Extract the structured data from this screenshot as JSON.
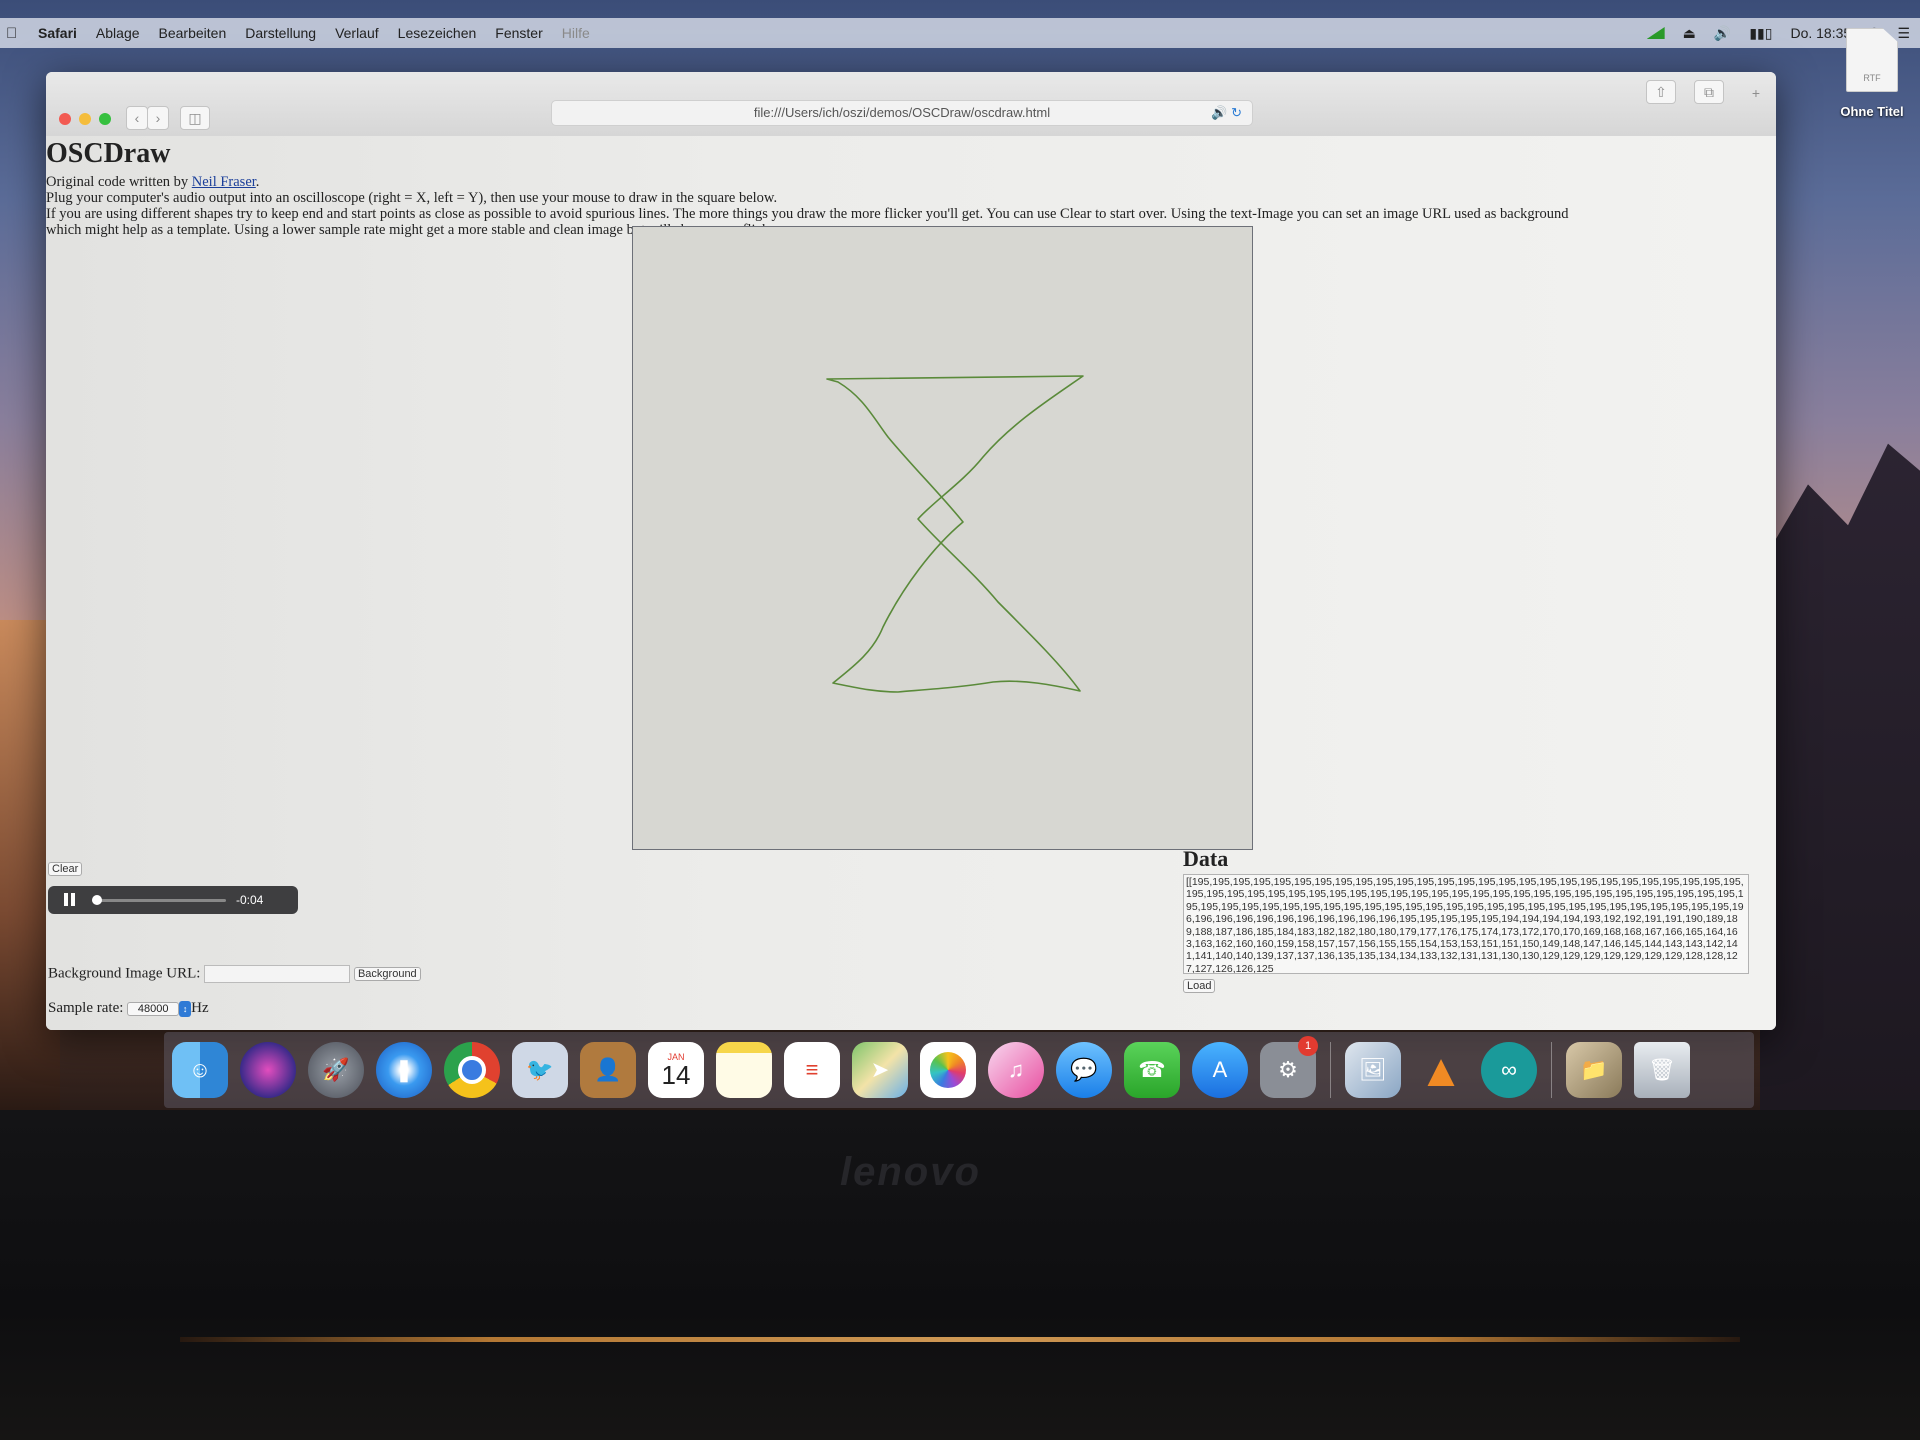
{
  "menubar": {
    "app": "Safari",
    "items": [
      "Ablage",
      "Bearbeiten",
      "Darstellung",
      "Verlauf",
      "Lesezeichen",
      "Fenster",
      "Hilfe"
    ],
    "clock": "Do. 18:35"
  },
  "desktop": {
    "file_badge": "RTF",
    "file_name": "Ohne Titel"
  },
  "browser": {
    "url": "file:///Users/ich/oszi/demos/OSCDraw/oscdraw.html"
  },
  "page": {
    "title": "OSCDraw",
    "credit_prefix": "Original code written by ",
    "credit_link": "Neil Fraser",
    "credit_suffix": ".",
    "line1": "Plug your computer's audio output into an oscilloscope (right = X, left = Y), then use your mouse to draw in the square below.",
    "line2": "If you are using different shapes try to keep end and start points as close as possible to avoid spurious lines. The more things you draw the more flicker you'll get. You can use Clear to start over. Using the text-Image you can set an image URL used as background",
    "line3": "which might help as a template. Using a lower sample rate might get a more stable and clean image but will show more flicker.",
    "clear_label": "Clear",
    "audio_time": "-0:04",
    "bg_label": "Background Image URL:",
    "bg_button": "Background",
    "rate_label": "Sample rate:",
    "rate_value": "48000",
    "rate_unit": "Hz",
    "data_heading": "Data",
    "data_text": "[[195,195,195,195,195,195,195,195,195,195,195,195,195,195,195,195,195,195,195,195,195,195,195,195,195,195,195,195,195,195,195,195,195,195,195,195,195,195,195,195,195,195,195,195,195,195,195,195,195,195,195,195,195,195,195,195,195,195,195,195,195,195,195,195,195,195,195,195,195,195,195,195,195,195,195,195,195,195,195,195,195,196,196,196,196,196,196,196,196,196,196,196,195,195,195,195,195,194,194,194,194,193,192,192,191,191,190,189,189,188,187,186,185,184,183,182,182,180,180,179,177,176,175,174,173,172,170,170,169,168,168,167,166,165,164,163,163,162,160,160,159,158,157,157,156,155,155,154,153,153,151,151,150,149,148,147,146,145,144,143,143,142,141,141,140,140,139,137,137,136,135,135,134,134,133,132,131,131,130,130,129,129,129,129,129,129,129,128,128,127,127,126,126,125",
    "load_label": "Load"
  },
  "dock": {
    "calendar_month": "JAN",
    "calendar_day": "14",
    "settings_badge": "1"
  },
  "bezel": {
    "brand": "lenovo"
  }
}
